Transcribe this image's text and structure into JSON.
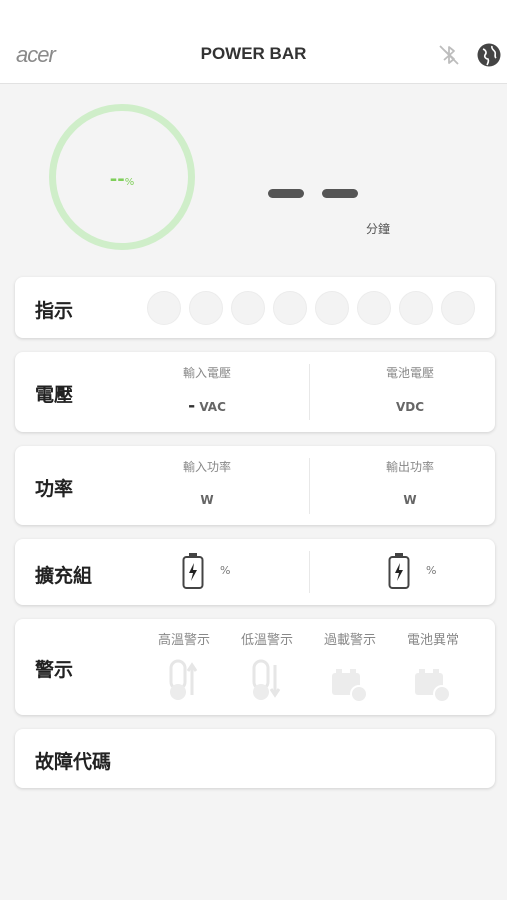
{
  "header": {
    "logo": "acer",
    "title": "POWER BAR",
    "icons": [
      "bluetooth-off-icon",
      "globe-icon"
    ]
  },
  "status": {
    "battery_percent": "--",
    "battery_unit": "%",
    "time_unit": "分鐘"
  },
  "indicator": {
    "label": "指示",
    "icons": [
      "icon-1",
      "icon-2",
      "icon-3",
      "icon-4",
      "icon-5",
      "icon-6",
      "icon-7",
      "icon-8"
    ]
  },
  "voltage": {
    "label": "電壓",
    "input_label": "輸入電壓",
    "input_value": "-",
    "input_unit": "VAC",
    "battery_label": "電池電壓",
    "battery_unit": "VDC"
  },
  "power": {
    "label": "功率",
    "input_label": "輸入功率",
    "input_unit": "W",
    "output_label": "輸出功率",
    "output_unit": "W"
  },
  "expansion": {
    "label": "擴充組",
    "pack1_unit": "%",
    "pack2_unit": "%"
  },
  "warning": {
    "label": "警示",
    "items": [
      "高溫警示",
      "低溫警示",
      "過載警示",
      "電池異常"
    ]
  },
  "fault": {
    "label": "故障代碼"
  },
  "colors": {
    "accent_green": "#7fcf5a",
    "ring_green": "#cfeec9"
  }
}
